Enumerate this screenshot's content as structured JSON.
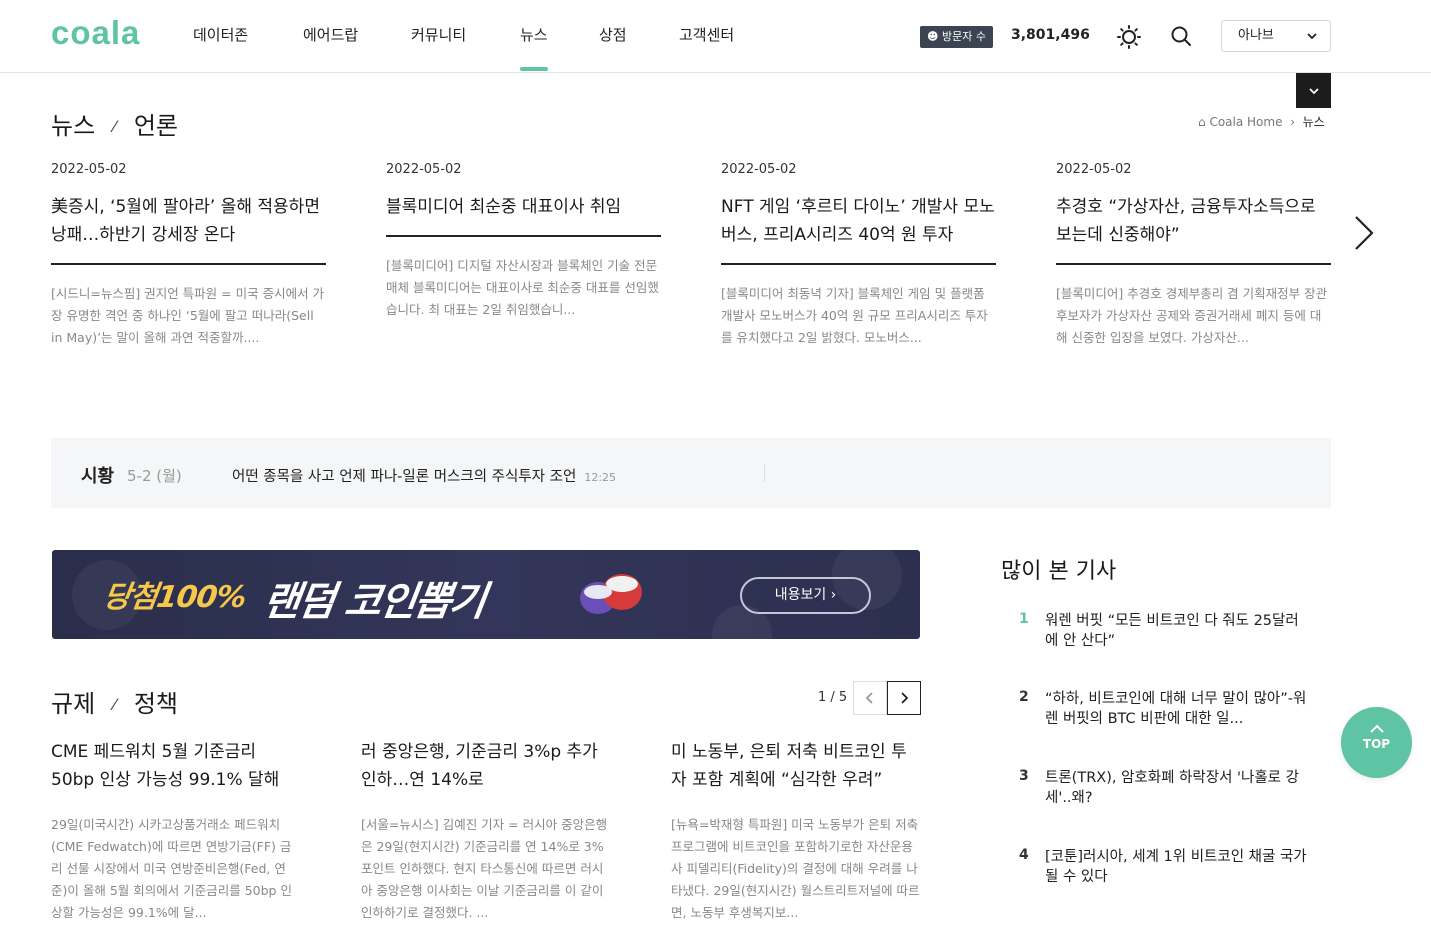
{
  "header": {
    "logo": "coala",
    "nav": [
      "데이터존",
      "에어드랍",
      "커뮤니티",
      "뉴스",
      "상점",
      "고객센터"
    ],
    "visitor_label": "방문자 수",
    "visitor_count": "3,801,496",
    "lang": "아나브"
  },
  "section1": {
    "title": "뉴스",
    "subtitle": "언론",
    "breadcrumb_home": "Coala Home",
    "breadcrumb_current": "뉴스"
  },
  "news_cards": [
    {
      "date": "2022-05-02",
      "title": "美증시, ‘5월에 팔아라’ 올해 적용하면 낭패…하반기 강세장 온다",
      "desc": "[시드니=뉴스핌] 권지언 특파원 = 미국 증시에서 가장 유명한 격언 중 하나인 ‘5월에 팔고 떠나라(Sell in May)’는 말이 올해 과연 적중할까...."
    },
    {
      "date": "2022-05-02",
      "title": "블록미디어 최순중 대표이사 취임",
      "desc": "[블록미디어] 디지털 자산시장과 블록체인 기술 전문 매체 블록미디어는 대표이사로 최순중 대표를 선임했습니다. 최 대표는 2일 취임했습니..."
    },
    {
      "date": "2022-05-02",
      "title": "NFT 게임 ‘후르티 다이노’ 개발사 모노버스, 프리A시리즈 40억 원 투자",
      "desc": "[블록미디어 최동녁 기자] 블록체인 게임 및 플랫폼 개발사 모노버스가 40억 원 규모 프리A시리즈 투자를 유치했다고 2일 밝혔다. 모노버스..."
    },
    {
      "date": "2022-05-02",
      "title": "추경호 “가상자산, 금융투자소득으로 보는데 신중해야”",
      "desc": "[블록미디어] 추경호 경제부총리 겸 기획재정부 장관 후보자가 가상자산 공제와 증권거래세 폐지 등에 대해 신중한 입장을 보였다. 가상자산..."
    }
  ],
  "market": {
    "label": "시황",
    "date": "5-2 (월)",
    "headline": "어떤 종목을 사고 언제 파나-일론 머스크의 주식투자 조언",
    "time": "12:25"
  },
  "banner": {
    "text1": "당첨100%",
    "text2": "랜덤 코인뽑기",
    "cta": "내용보기 ›"
  },
  "section2": {
    "title": "규제",
    "subtitle": "정책",
    "pager": "1 / 5"
  },
  "policy_cards": [
    {
      "title": "CME 페드워치 5월 기준금리 50bp 인상 가능성 99.1% 달해",
      "desc": "29일(미국시간) 시카고상품거래소 페드워치(CME Fedwatch)에 따르면 연방기금(FF) 금리 선물 시장에서 미국 연방준비은행(Fed, 연준)이 올해 5월 회의에서 기준금리를 50bp 인상할 가능성은 99.1%에 달..."
    },
    {
      "title": "러 중앙은행, 기준금리 3%p 추가 인하…연 14%로",
      "desc": "[서울=뉴시스] 김예진 기자 = 러시아 중앙은행은 29일(현지시간) 기준금리를 연 14%로 3% 포인트 인하했다. 현지 타스통신에 따르면 러시아 중앙은행 이사회는 이날 기준금리를 이 같이 인하하기로 결정했다. ..."
    },
    {
      "title": "미 노동부, 은퇴 저축 비트코인 투자 포함 계획에 “심각한 우려”",
      "desc": "[뉴욕=박재형 특파원] 미국 노동부가 은퇴 저축 프로그램에 비트코인을 포함하기로한 자산운용사 피델리티(Fidelity)의 결정에 대해 우려를 나타냈다. 29일(현지시간) 월스트리트저널에 따르면, 노동부 후생복지보..."
    }
  ],
  "most_read": {
    "title": "많이 본 기사",
    "items": [
      {
        "num": "1",
        "text": "워렌 버핏 “모든 비트코인 다 줘도 25달러에 안 산다”"
      },
      {
        "num": "2",
        "text": "“하하, 비트코인에 대해 너무 말이 많아”-워렌 버핏의 BTC 비판에 대한 일..."
      },
      {
        "num": "3",
        "text": "트론(TRX), 암호화폐 하락장서 '나홀로 강세'..왜?"
      },
      {
        "num": "4",
        "text": "[코툰]러시아, 세계 1위 비트코인 채굴 국가 될 수 있다"
      }
    ]
  },
  "top_button": "TOP",
  "colors": {
    "accent": "#5ec4a4",
    "dark": "#1c1c1c"
  }
}
